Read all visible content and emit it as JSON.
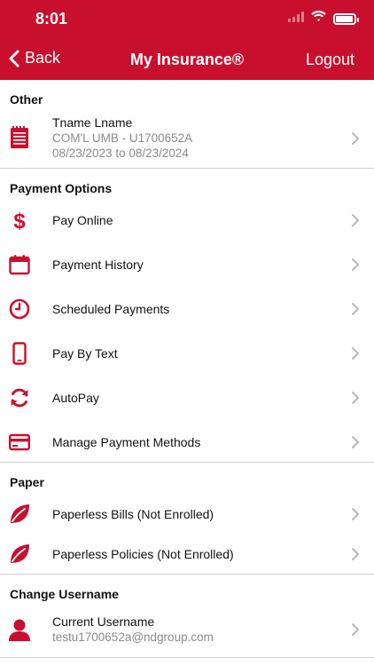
{
  "status_bar": {
    "time": "8:01"
  },
  "nav": {
    "back_label": "Back",
    "title": "My Insurance®",
    "logout_label": "Logout"
  },
  "sections": {
    "other": {
      "title": "Other",
      "policy": {
        "name": "Tname Lname",
        "policy_line": "COM'L UMB - U1700652A",
        "dates": "08/23/2023 to 08/23/2024",
        "icon": "policy-document-icon"
      }
    },
    "payment_options": {
      "title": "Payment Options",
      "items": [
        {
          "label": "Pay Online",
          "icon": "dollar-icon"
        },
        {
          "label": "Payment History",
          "icon": "calendar-icon"
        },
        {
          "label": "Scheduled Payments",
          "icon": "clock-icon"
        },
        {
          "label": "Pay By Text",
          "icon": "phone-icon"
        },
        {
          "label": "AutoPay",
          "icon": "refresh-icon"
        },
        {
          "label": "Manage Payment Methods",
          "icon": "credit-card-icon"
        }
      ]
    },
    "paper": {
      "title": "Paper",
      "items": [
        {
          "label": "Paperless Bills (Not Enrolled)",
          "icon": "leaf-icon"
        },
        {
          "label": "Paperless Policies (Not Enrolled)",
          "icon": "leaf-icon"
        }
      ]
    },
    "change_username": {
      "title": "Change Username",
      "current": {
        "label": "Current Username",
        "value": "testu1700652a@ndgroup.com",
        "icon": "user-icon"
      }
    }
  },
  "colors": {
    "brand": "#c8102e",
    "chevron": "#b8b8b8",
    "subtext": "#8a8a8a"
  }
}
